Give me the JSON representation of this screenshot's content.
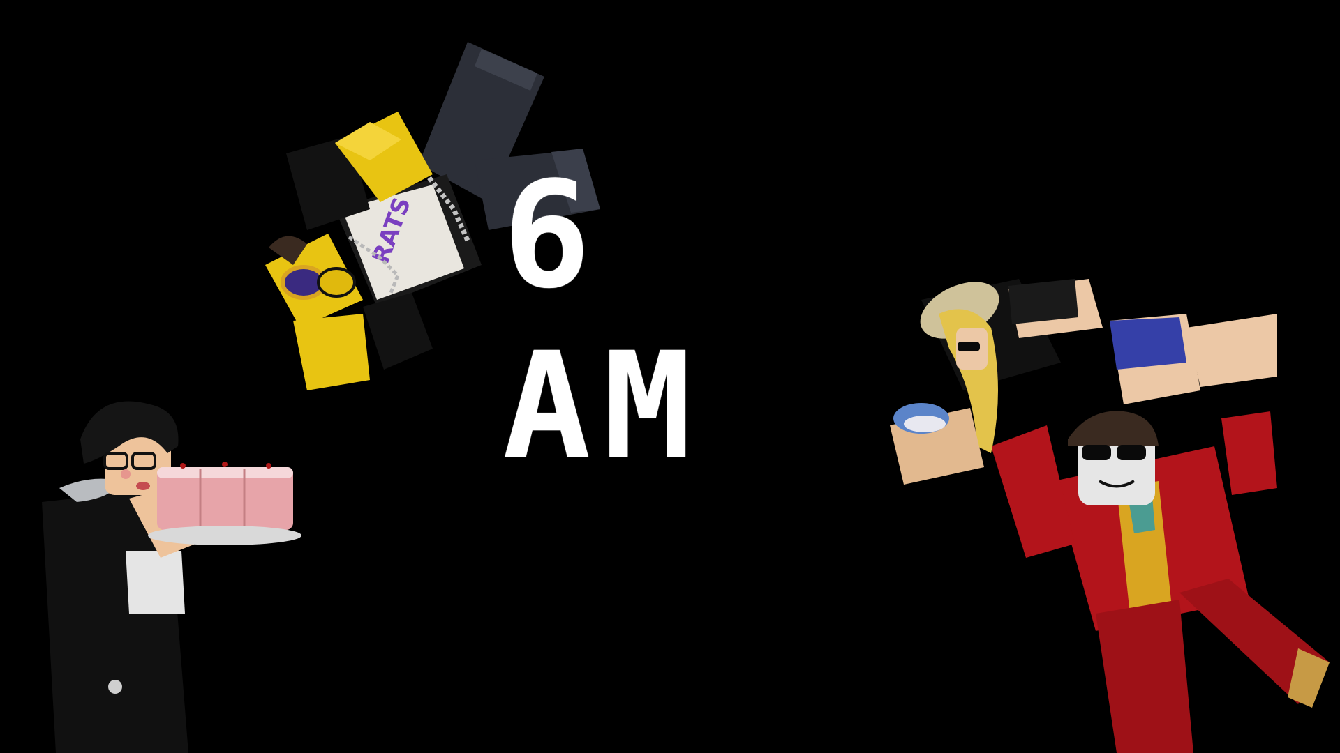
{
  "scene": {
    "background_color": "#000000",
    "hour_label": "6 AM",
    "text_color": "#ffffff"
  },
  "characters": [
    {
      "name": "falling-yellow-avatar",
      "colors": {
        "skin": "#e8c412",
        "torso": "#1a1a1a",
        "legs": "#2c2f38"
      }
    },
    {
      "name": "cake-holding-avatar",
      "colors": {
        "jacket": "#121212",
        "cake": "#e7a4a9"
      }
    },
    {
      "name": "red-suit-avatar-lifting",
      "colors": {
        "suit": "#b3141b",
        "vest": "#d9a521",
        "skin": "#e8c29f"
      }
    }
  ]
}
